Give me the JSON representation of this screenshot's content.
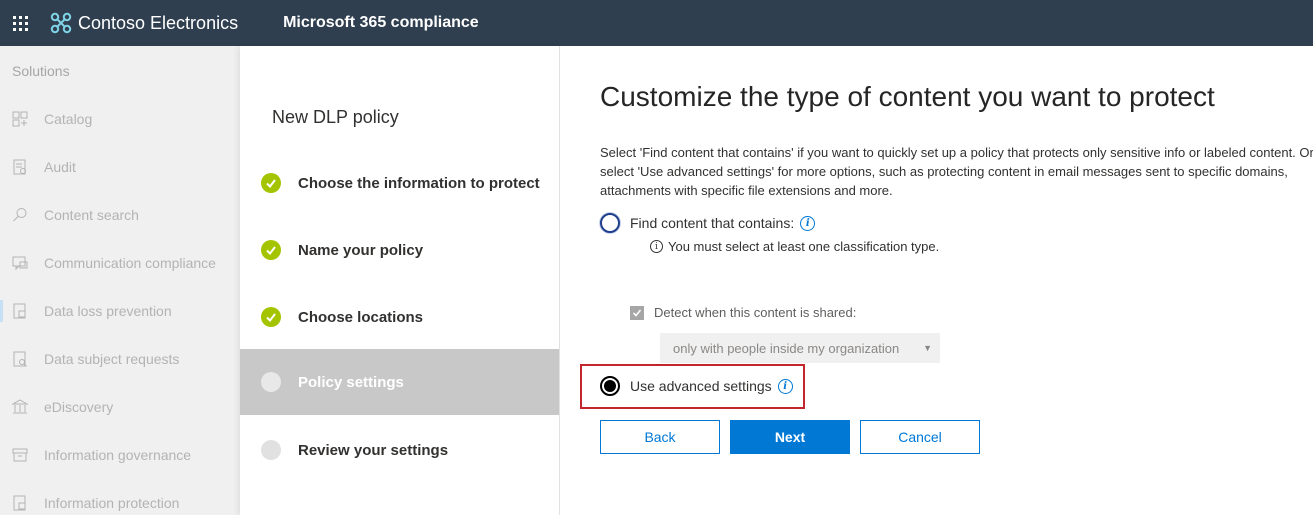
{
  "topbar": {
    "brand_name": "Contoso Electronics",
    "app_name": "Microsoft 365 compliance"
  },
  "leftnav": {
    "header": "Solutions",
    "items": [
      {
        "label": "Catalog",
        "icon": "catalog-icon"
      },
      {
        "label": "Audit",
        "icon": "audit-icon"
      },
      {
        "label": "Content search",
        "icon": "search-icon"
      },
      {
        "label": "Communication compliance",
        "icon": "communication-icon"
      },
      {
        "label": "Data loss prevention",
        "icon": "dlp-icon"
      },
      {
        "label": "Data subject requests",
        "icon": "data-subject-icon"
      },
      {
        "label": "eDiscovery",
        "icon": "ediscovery-icon"
      },
      {
        "label": "Information governance",
        "icon": "governance-icon"
      },
      {
        "label": "Information protection",
        "icon": "protection-icon"
      }
    ]
  },
  "wizard": {
    "title": "New DLP policy",
    "steps": [
      {
        "label": "Choose the information to protect",
        "status": "done"
      },
      {
        "label": "Name your policy",
        "status": "done"
      },
      {
        "label": "Choose locations",
        "status": "done"
      },
      {
        "label": "Policy settings",
        "status": "current"
      },
      {
        "label": "Review your settings",
        "status": "pending"
      }
    ]
  },
  "main": {
    "title": "Customize the type of content you want to protect",
    "description": "Select 'Find content that contains' if you want to quickly set up a policy that protects only sensitive info or labeled content. Or select 'Use advanced settings' for more options, such as protecting content in email messages sent to specific domains, attachments with specific file extensions and more.",
    "option_find": "Find content that contains:",
    "hint": "You must select at least one classification type.",
    "detect_label": "Detect when this content is shared:",
    "dropdown_value": "only with people inside my organization",
    "option_advanced": "Use advanced settings",
    "buttons": {
      "back": "Back",
      "next": "Next",
      "cancel": "Cancel"
    }
  },
  "colors": {
    "topbar": "#2f3f4f",
    "accent": "#0078d4",
    "step_done": "#a4c400",
    "highlight": "#c4262e"
  }
}
